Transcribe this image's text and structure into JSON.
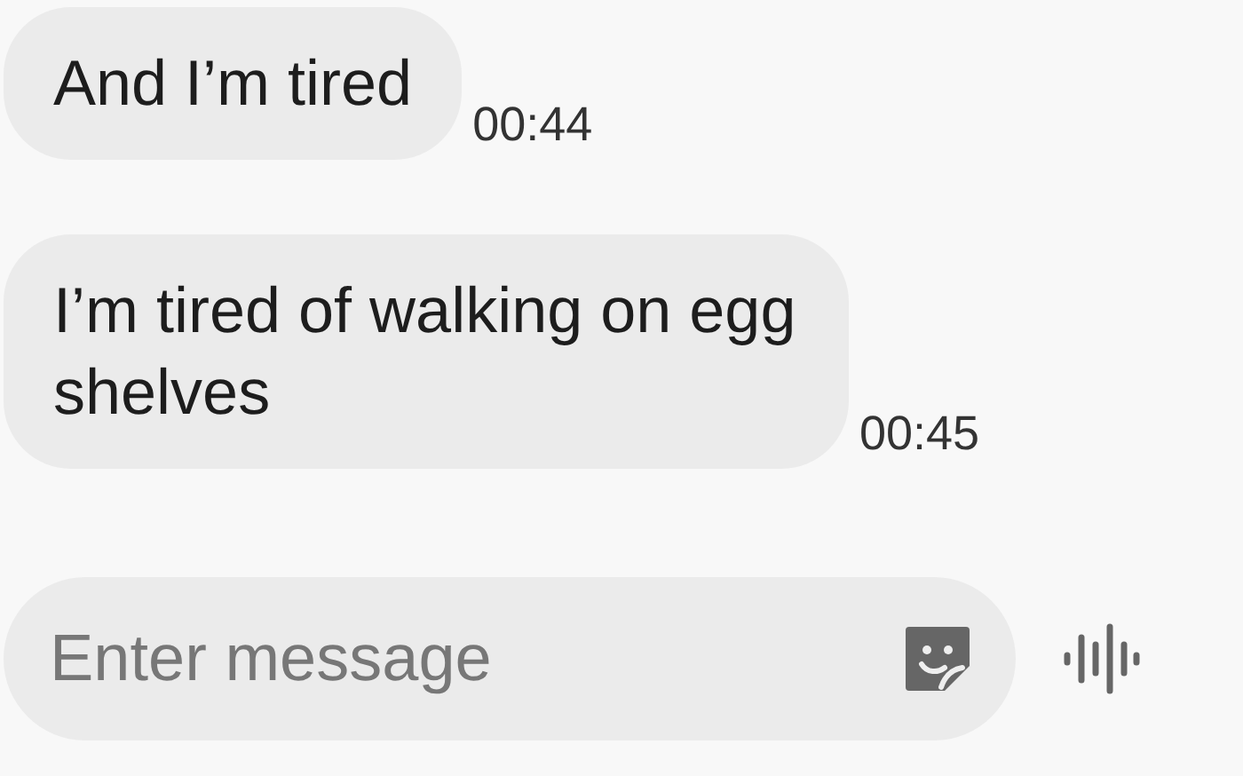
{
  "messages": [
    {
      "text": "And I’m tired",
      "time": "00:44"
    },
    {
      "text": "I’m tired of walking on egg shelves",
      "time": "00:45"
    }
  ],
  "composer": {
    "placeholder": "Enter message"
  }
}
